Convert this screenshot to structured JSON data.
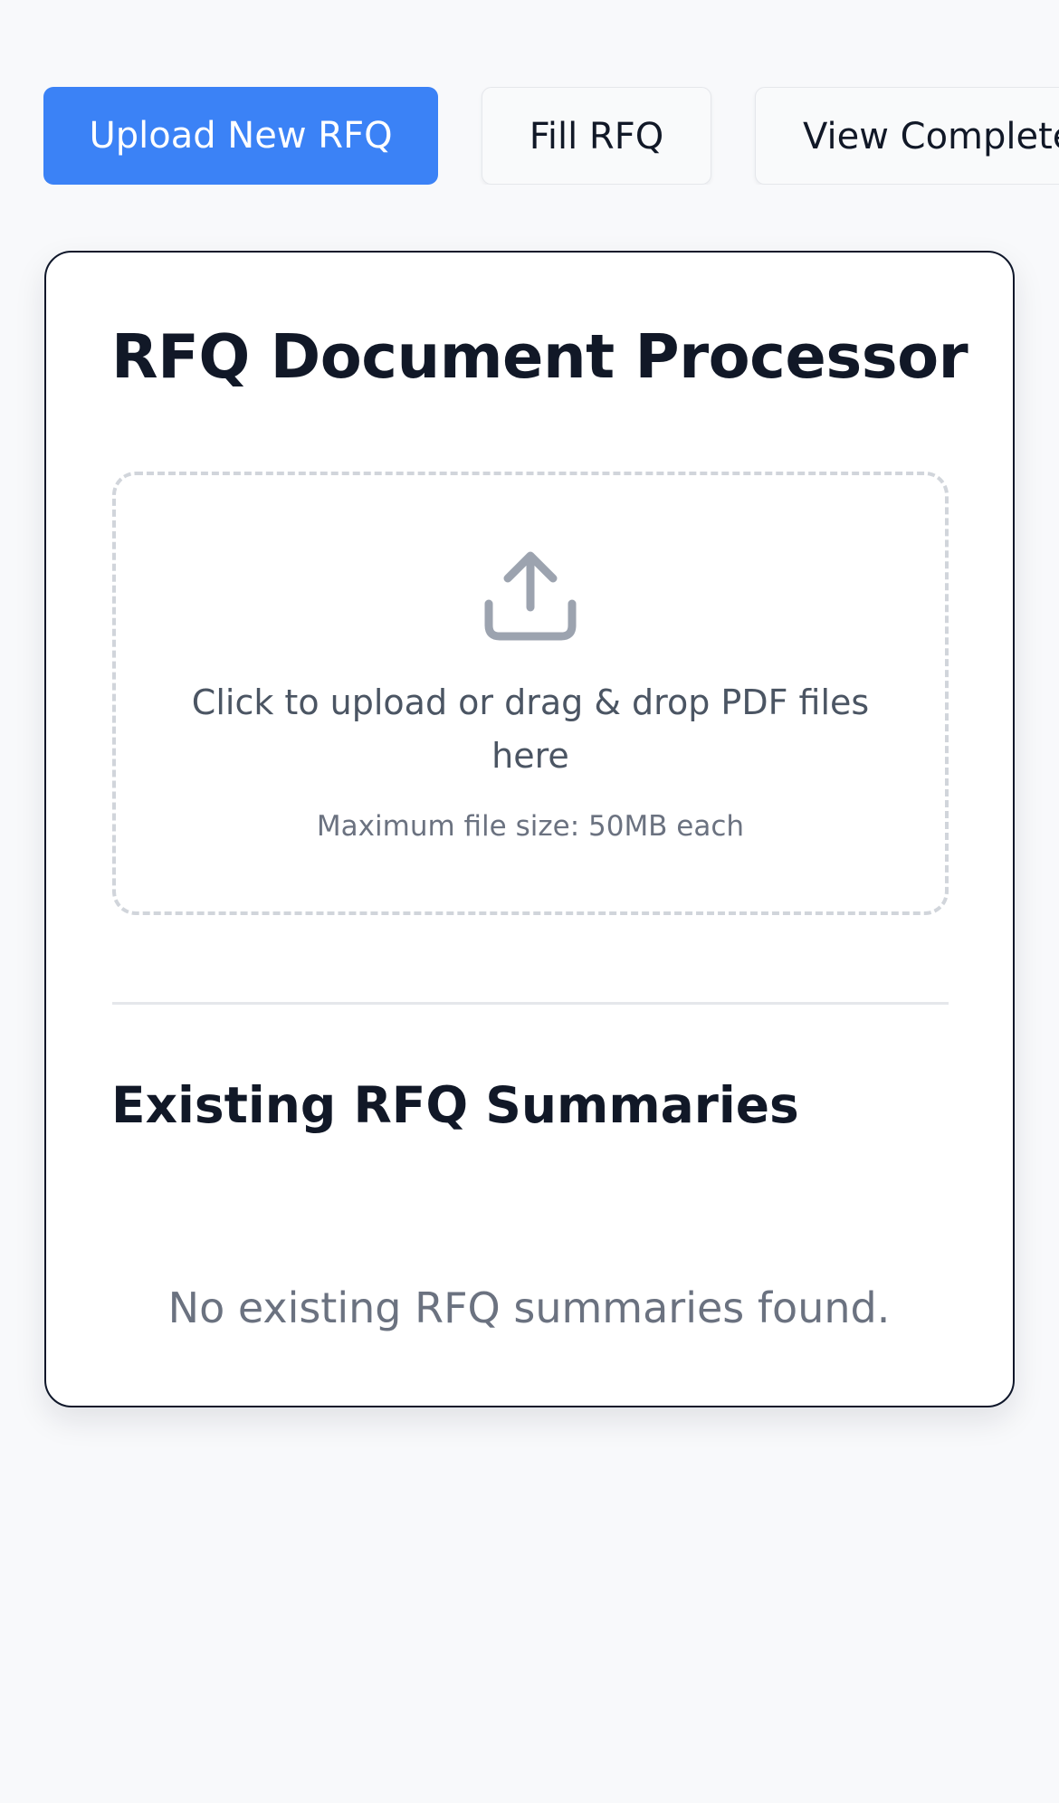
{
  "nav": {
    "tabs": [
      {
        "label": "Upload New RFQ",
        "active": true
      },
      {
        "label": "Fill RFQ",
        "active": false
      },
      {
        "label": "View Completed",
        "active": false
      }
    ]
  },
  "processor": {
    "title": "RFQ Document Processor",
    "dropzone": {
      "icon": "upload-icon",
      "text": "Click to upload or drag & drop PDF files here",
      "hint": "Maximum file size: 50MB each"
    }
  },
  "summaries": {
    "title": "Existing RFQ Summaries",
    "empty_message": "No existing RFQ summaries found."
  },
  "colors": {
    "accent": "#3b82f6",
    "background": "#f8f9fb",
    "card_border": "#0f172a",
    "dropzone_border": "#d1d5db",
    "icon": "#9ca3af",
    "muted_text": "#6b7280"
  }
}
